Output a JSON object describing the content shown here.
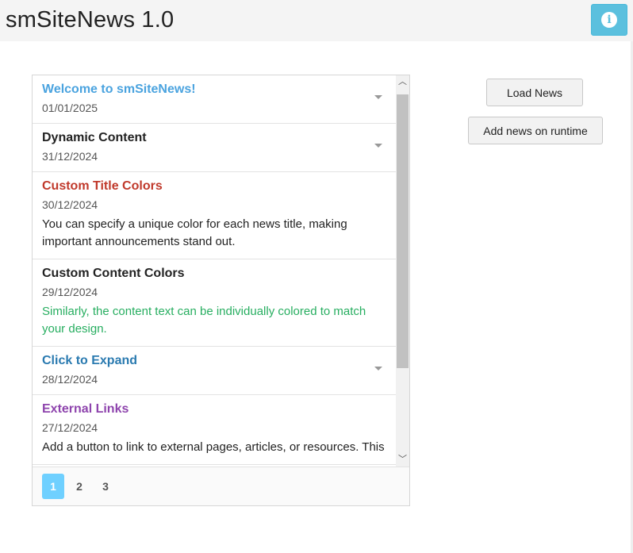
{
  "app": {
    "title": "smSiteNews 1.0"
  },
  "header": {
    "info_icon": "info-icon",
    "info_glyph": "i",
    "info_color": "#5bc0de"
  },
  "news": {
    "items": [
      {
        "title": "Welcome to smSiteNews!",
        "date": "01/01/2025",
        "content": "",
        "title_color": "#4aa3df",
        "content_color": "",
        "collapsed": true
      },
      {
        "title": "Dynamic Content",
        "date": "31/12/2024",
        "content": "",
        "title_color": "#222222",
        "content_color": "",
        "collapsed": true
      },
      {
        "title": "Custom Title Colors",
        "date": "30/12/2024",
        "content": "You can specify a unique color for each news title, making important announcements stand out.",
        "title_color": "#c0392b",
        "content_color": "#222222",
        "collapsed": false
      },
      {
        "title": "Custom Content Colors",
        "date": "29/12/2024",
        "content": "Similarly, the content text can be individually colored to match your design.",
        "title_color": "#222222",
        "content_color": "#27ae60",
        "collapsed": false
      },
      {
        "title": "Click to Expand",
        "date": "28/12/2024",
        "content": "",
        "title_color": "#2a7ab0",
        "content_color": "",
        "collapsed": true
      },
      {
        "title": "External Links",
        "date": "27/12/2024",
        "content": "Add a button to link to external pages, articles, or resources. This",
        "title_color": "#8e44ad",
        "content_color": "#222222",
        "collapsed": false
      }
    ],
    "pagination": {
      "pages": [
        "1",
        "2",
        "3"
      ],
      "active": "1"
    },
    "scroll": {
      "up_glyph": "︿",
      "down_glyph": "﹀"
    }
  },
  "actions": {
    "load_news": "Load News",
    "add_news": "Add news on runtime"
  }
}
